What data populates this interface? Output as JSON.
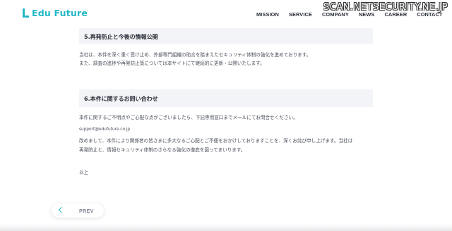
{
  "header": {
    "logo_text": "Edu Future",
    "nav": [
      "MISSION",
      "SERVICE",
      "COMPANY",
      "NEWS",
      "CAREER",
      "CONTACT"
    ],
    "watermark": "SCAN.NETSECURITY.NE.JP"
  },
  "section5": {
    "title": "5.再発防止と今後の情報公開",
    "lines": [
      "当社は、本件を深く重く受け止め、外部専門組織の助言を踏まえたセキュリティ体制の強化を進めております。",
      "また、調査の進捗や再発防止策については本サイトにて継続的に更新・公開いたします。"
    ]
  },
  "section6": {
    "title": "6.本件に関するお問い合わせ",
    "intro": "本件に関するご不明点やご心配な点がございましたら、下記専用窓口までメールにてお問合せください。",
    "email": "support@edufuture.co.jp",
    "apology": [
      "改めまして、本件により関係者の皆さまに多大なるご心配とご不便をおかけしておりますことを、深くお詫び申し上げます。当社は",
      "再発防止と、情報セキュリティ体制のさらなる強化の徹底を図ってまいります。"
    ],
    "closing": "以上"
  },
  "pager": {
    "prev_label": "PREV"
  },
  "colors": {
    "accent": "#1fb8c6",
    "section_bg": "#f3f4f7",
    "text": "#3a3f4b"
  }
}
